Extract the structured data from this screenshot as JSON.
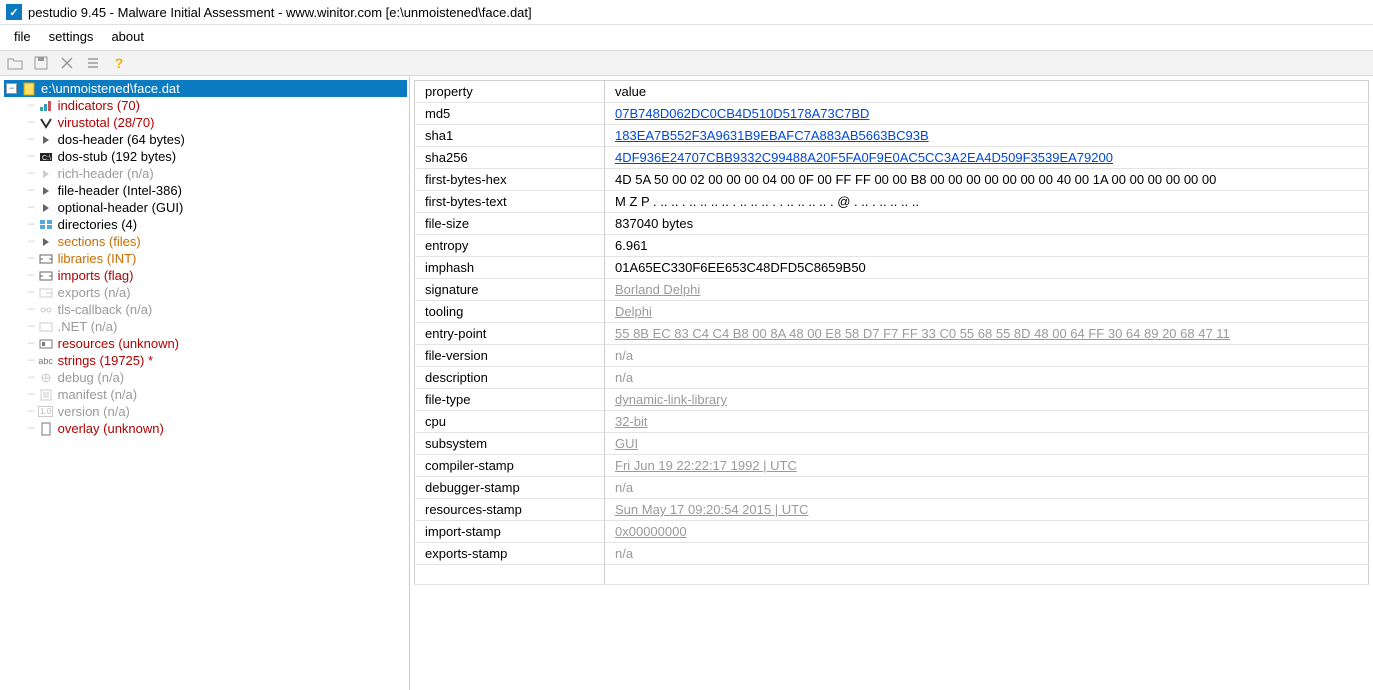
{
  "window": {
    "title": "pestudio 9.45 - Malware Initial Assessment - www.winitor.com [e:\\unmoistened\\face.dat]"
  },
  "menu": {
    "file": "file",
    "settings": "settings",
    "about": "about"
  },
  "tree": {
    "root": "e:\\unmoistened\\face.dat",
    "items": [
      {
        "label": "indicators (70)",
        "cls": "c-red",
        "icon": "bars"
      },
      {
        "label": "virustotal (28/70)",
        "cls": "c-red",
        "icon": "vt"
      },
      {
        "label": "dos-header (64 bytes)",
        "cls": "c-normal",
        "icon": "tri"
      },
      {
        "label": "dos-stub (192 bytes)",
        "cls": "c-normal",
        "icon": "stub"
      },
      {
        "label": "rich-header (n/a)",
        "cls": "c-grey",
        "icon": "tri-grey"
      },
      {
        "label": "file-header (Intel-386)",
        "cls": "c-normal",
        "icon": "tri"
      },
      {
        "label": "optional-header (GUI)",
        "cls": "c-normal",
        "icon": "tri"
      },
      {
        "label": "directories (4)",
        "cls": "c-normal",
        "icon": "dir"
      },
      {
        "label": "sections (files)",
        "cls": "c-orange",
        "icon": "tri"
      },
      {
        "label": "libraries (INT)",
        "cls": "c-orange",
        "icon": "lib"
      },
      {
        "label": "imports (flag)",
        "cls": "c-red",
        "icon": "lib"
      },
      {
        "label": "exports (n/a)",
        "cls": "c-grey",
        "icon": "exp"
      },
      {
        "label": "tls-callback (n/a)",
        "cls": "c-grey",
        "icon": "tls"
      },
      {
        "label": ".NET (n/a)",
        "cls": "c-grey",
        "icon": "net"
      },
      {
        "label": "resources (unknown)",
        "cls": "c-red",
        "icon": "res"
      },
      {
        "label": "strings (19725) *",
        "cls": "c-red",
        "icon": "str"
      },
      {
        "label": "debug (n/a)",
        "cls": "c-grey",
        "icon": "dbg"
      },
      {
        "label": "manifest (n/a)",
        "cls": "c-grey",
        "icon": "man"
      },
      {
        "label": "version (n/a)",
        "cls": "c-grey",
        "icon": "ver"
      },
      {
        "label": "overlay (unknown)",
        "cls": "c-red",
        "icon": "ovl"
      }
    ]
  },
  "table": {
    "headers": {
      "property": "property",
      "value": "value"
    },
    "rows": [
      {
        "prop": "md5",
        "val": "07B748D062DC0CB4D510D5178A73C7BD",
        "style": "link"
      },
      {
        "prop": "sha1",
        "val": "183EA7B552F3A9631B9EBAFC7A883AB5663BC93B",
        "style": "link"
      },
      {
        "prop": "sha256",
        "val": "4DF936E24707CBB9332C99488A20F5FA0F9E0AC5CC3A2EA4D509F3539EA79200",
        "style": "link"
      },
      {
        "prop": "first-bytes-hex",
        "val": "4D 5A 50 00 02 00 00 00 04 00 0F 00 FF FF 00 00 B8 00 00 00 00 00 00 00 40 00 1A 00 00 00 00 00 00",
        "style": "plain"
      },
      {
        "prop": "first-bytes-text",
        "val": "M Z P . .. .. . .. .. .. .. . .. .. .. . . .. .. .. .. . @ . .. . .. .. .. ..",
        "style": "plain"
      },
      {
        "prop": "file-size",
        "val": "837040 bytes",
        "style": "plain"
      },
      {
        "prop": "entropy",
        "val": "6.961",
        "style": "plain"
      },
      {
        "prop": "imphash",
        "val": "01A65EC330F6EE653C48DFD5C8659B50",
        "style": "plain"
      },
      {
        "prop": "signature",
        "val": "Borland Delphi",
        "style": "grey-u"
      },
      {
        "prop": "tooling",
        "val": "Delphi",
        "style": "grey-u"
      },
      {
        "prop": "entry-point",
        "val": "55 8B EC 83 C4 C4 B8 00 8A 48 00 E8 58 D7 F7 FF 33 C0 55 68 55 8D 48 00 64 FF 30 64 89 20 68 47 11",
        "style": "grey-u"
      },
      {
        "prop": "file-version",
        "val": "n/a",
        "style": "grey"
      },
      {
        "prop": "description",
        "val": "n/a",
        "style": "grey"
      },
      {
        "prop": "file-type",
        "val": "dynamic-link-library",
        "style": "grey-u"
      },
      {
        "prop": "cpu",
        "val": "32-bit",
        "style": "grey-u"
      },
      {
        "prop": "subsystem",
        "val": "GUI",
        "style": "grey-u"
      },
      {
        "prop": "compiler-stamp",
        "val": "Fri Jun 19 22:22:17 1992 | UTC",
        "style": "grey-u"
      },
      {
        "prop": "debugger-stamp",
        "val": "n/a",
        "style": "grey"
      },
      {
        "prop": "resources-stamp",
        "val": "Sun May 17 09:20:54 2015 | UTC",
        "style": "grey-u"
      },
      {
        "prop": "import-stamp",
        "val": "0x00000000",
        "style": "grey-u"
      },
      {
        "prop": "exports-stamp",
        "val": "n/a",
        "style": "grey"
      }
    ]
  }
}
